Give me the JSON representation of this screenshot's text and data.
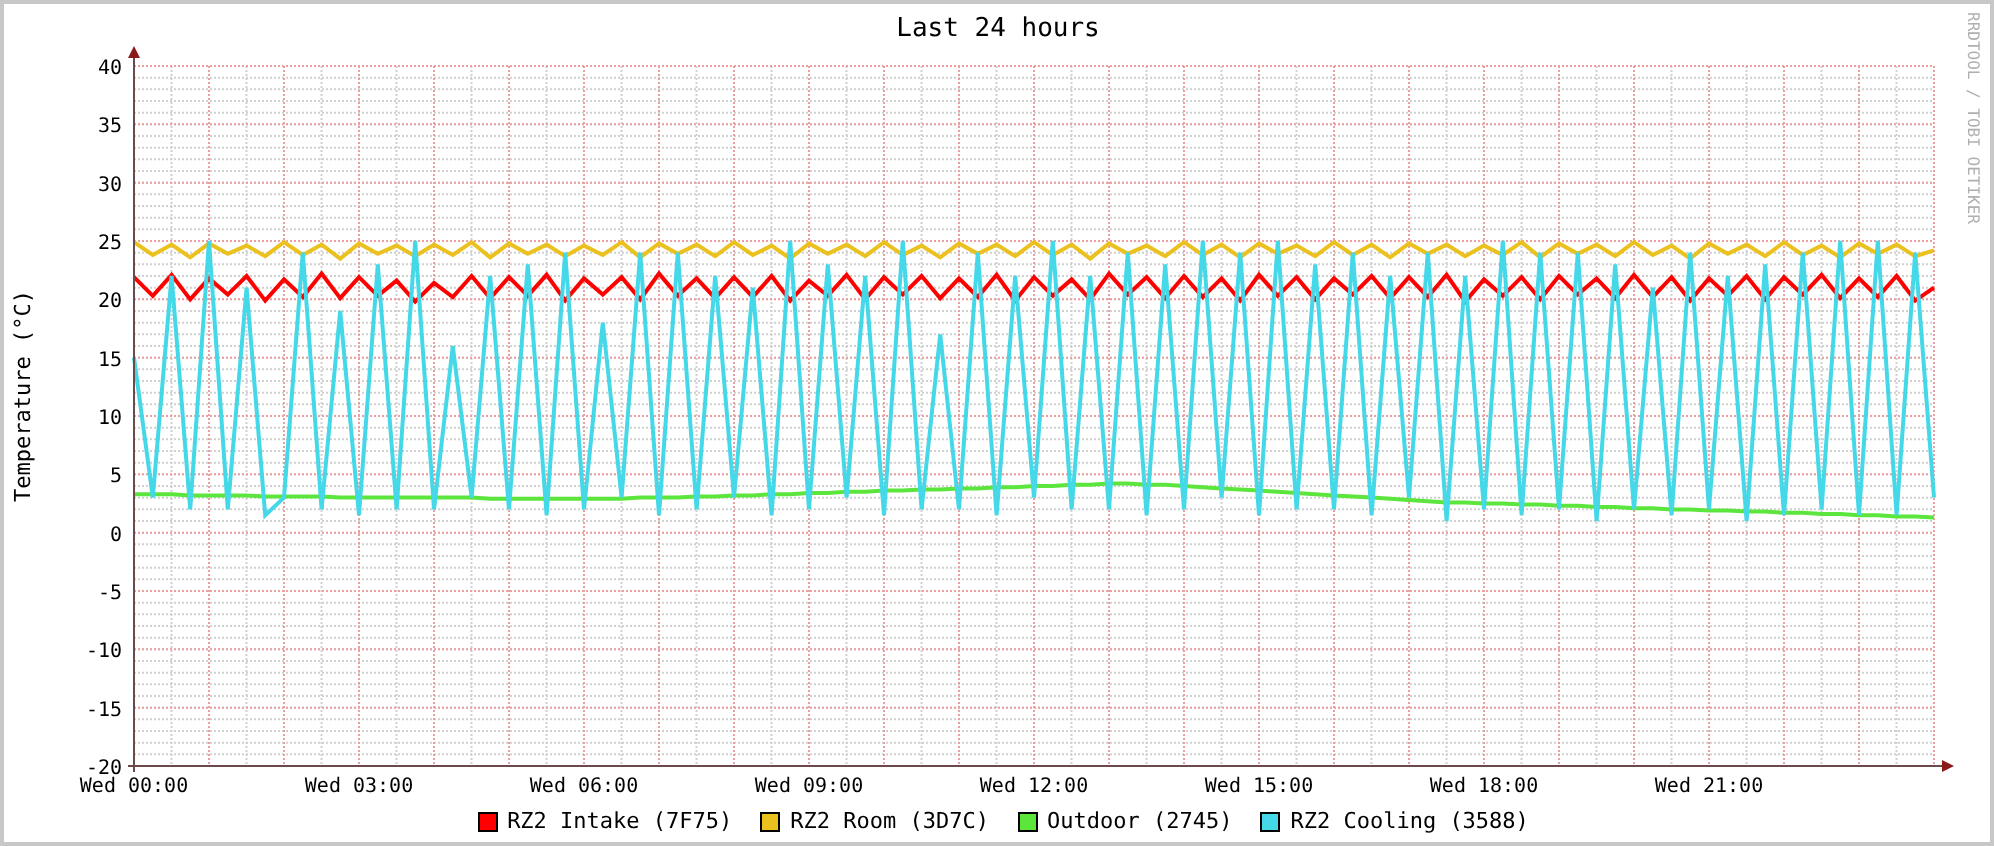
{
  "graph": {
    "credit": "RRDTOOL / TOBI OETIKER",
    "chart_data": {
      "type": "line",
      "grid": true,
      "title": "Last 24 hours",
      "ylabel": "Temperature (°C)",
      "ylim": [
        -20,
        40
      ],
      "yticks": [
        -20,
        -15,
        -10,
        -5,
        0,
        5,
        10,
        15,
        20,
        25,
        30,
        35,
        40
      ],
      "categories": [
        "Wed 00:00",
        null,
        null,
        null,
        null,
        null,
        null,
        null,
        null,
        null,
        null,
        null,
        "Wed 03:00",
        null,
        null,
        null,
        null,
        null,
        null,
        null,
        null,
        null,
        null,
        null,
        "Wed 06:00",
        null,
        null,
        null,
        null,
        null,
        null,
        null,
        null,
        null,
        null,
        null,
        "Wed 09:00",
        null,
        null,
        null,
        null,
        null,
        null,
        null,
        null,
        null,
        null,
        null,
        "Wed 12:00",
        null,
        null,
        null,
        null,
        null,
        null,
        null,
        null,
        null,
        null,
        null,
        "Wed 15:00",
        null,
        null,
        null,
        null,
        null,
        null,
        null,
        null,
        null,
        null,
        null,
        "Wed 18:00",
        null,
        null,
        null,
        null,
        null,
        null,
        null,
        null,
        null,
        null,
        null,
        "Wed 21:00",
        null,
        null,
        null,
        null,
        null,
        null,
        null,
        null,
        null,
        null,
        null,
        null
      ],
      "series": [
        {
          "name": "RZ2 Intake (7F75)",
          "color": "#ff0000",
          "values": [
            21.9,
            20.3,
            22.1,
            20.0,
            21.8,
            20.4,
            22.0,
            19.9,
            21.7,
            20.2,
            22.2,
            20.1,
            21.9,
            20.3,
            21.6,
            19.8,
            21.4,
            20.2,
            22.0,
            20.1,
            21.9,
            20.3,
            22.1,
            19.9,
            21.8,
            20.4,
            21.9,
            20.0,
            22.2,
            20.3,
            21.8,
            20.1,
            21.9,
            20.2,
            22.0,
            19.9,
            21.6,
            20.3,
            22.1,
            20.0,
            21.9,
            20.4,
            22.0,
            20.1,
            21.8,
            20.2,
            22.1,
            19.9,
            21.9,
            20.3,
            21.7,
            20.0,
            22.2,
            20.4,
            21.9,
            20.1,
            22.0,
            20.2,
            21.8,
            19.9,
            22.1,
            20.3,
            21.9,
            20.0,
            21.8,
            20.4,
            22.0,
            20.1,
            21.9,
            20.2,
            22.1,
            19.8,
            21.7,
            20.3,
            21.9,
            20.0,
            22.0,
            20.4,
            21.8,
            20.1,
            22.1,
            20.2,
            21.9,
            19.9,
            21.8,
            20.3,
            22.0,
            20.0,
            21.9,
            20.4,
            22.1,
            20.1,
            21.8,
            20.2,
            22.0,
            19.9,
            21.0
          ]
        },
        {
          "name": "RZ2 Room (3D7C)",
          "color": "#eac11f",
          "values": [
            24.9,
            23.8,
            24.7,
            23.6,
            24.8,
            23.9,
            24.6,
            23.7,
            24.9,
            23.8,
            24.7,
            23.5,
            24.8,
            23.9,
            24.6,
            23.7,
            24.7,
            23.8,
            24.9,
            23.6,
            24.8,
            23.9,
            24.7,
            23.7,
            24.6,
            23.8,
            24.9,
            23.6,
            24.8,
            23.9,
            24.7,
            23.7,
            24.9,
            23.8,
            24.6,
            23.5,
            24.8,
            23.9,
            24.7,
            23.7,
            24.9,
            23.8,
            24.6,
            23.6,
            24.8,
            23.9,
            24.7,
            23.7,
            24.9,
            23.8,
            24.7,
            23.5,
            24.8,
            23.9,
            24.6,
            23.7,
            24.9,
            23.8,
            24.7,
            23.6,
            24.8,
            23.9,
            24.6,
            23.7,
            24.9,
            23.8,
            24.7,
            23.6,
            24.8,
            23.9,
            24.7,
            23.7,
            24.6,
            23.8,
            24.9,
            23.6,
            24.8,
            23.9,
            24.7,
            23.7,
            24.9,
            23.8,
            24.6,
            23.5,
            24.8,
            23.9,
            24.7,
            23.7,
            24.9,
            23.8,
            24.6,
            23.6,
            24.8,
            23.9,
            24.7,
            23.7,
            24.2
          ]
        },
        {
          "name": "Outdoor (2745)",
          "color": "#5ce53c",
          "values": [
            3.3,
            3.3,
            3.3,
            3.2,
            3.2,
            3.2,
            3.2,
            3.1,
            3.1,
            3.1,
            3.1,
            3.0,
            3.0,
            3.0,
            3.0,
            3.0,
            3.0,
            3.0,
            3.0,
            2.9,
            2.9,
            2.9,
            2.9,
            2.9,
            2.9,
            2.9,
            2.9,
            3.0,
            3.0,
            3.0,
            3.1,
            3.1,
            3.2,
            3.2,
            3.3,
            3.3,
            3.4,
            3.4,
            3.5,
            3.5,
            3.6,
            3.6,
            3.7,
            3.7,
            3.8,
            3.8,
            3.9,
            3.9,
            4.0,
            4.0,
            4.1,
            4.1,
            4.2,
            4.2,
            4.1,
            4.1,
            4.0,
            3.9,
            3.8,
            3.7,
            3.6,
            3.5,
            3.4,
            3.3,
            3.2,
            3.1,
            3.0,
            2.9,
            2.8,
            2.7,
            2.6,
            2.6,
            2.5,
            2.5,
            2.4,
            2.4,
            2.3,
            2.3,
            2.2,
            2.2,
            2.1,
            2.1,
            2.0,
            2.0,
            1.9,
            1.9,
            1.8,
            1.8,
            1.7,
            1.7,
            1.6,
            1.6,
            1.5,
            1.5,
            1.4,
            1.4,
            1.3
          ]
        },
        {
          "name": "RZ2 Cooling (3588)",
          "color": "#44d8e8",
          "values": [
            15,
            3,
            22,
            2,
            25,
            2,
            21,
            1.5,
            3,
            24,
            2,
            19,
            1.5,
            23,
            2,
            25,
            2,
            16,
            3,
            22,
            2,
            23,
            1.5,
            24,
            2,
            18,
            3,
            24,
            1.5,
            24,
            2,
            22,
            3,
            21,
            1.5,
            25,
            2,
            23,
            3,
            22,
            1.5,
            25,
            2,
            17,
            2,
            24,
            1.5,
            22,
            3,
            25,
            2,
            22,
            2,
            24,
            1.5,
            23,
            2,
            25,
            3,
            24,
            1.5,
            25,
            2,
            23,
            2,
            24,
            1.5,
            22,
            3,
            24,
            1,
            22,
            2,
            25,
            1.5,
            24,
            2,
            24,
            1,
            23,
            2,
            21,
            1.5,
            24,
            2,
            22,
            1,
            23,
            1.5,
            24,
            2,
            25,
            1.5,
            25,
            1.5,
            24,
            3
          ]
        }
      ]
    }
  }
}
